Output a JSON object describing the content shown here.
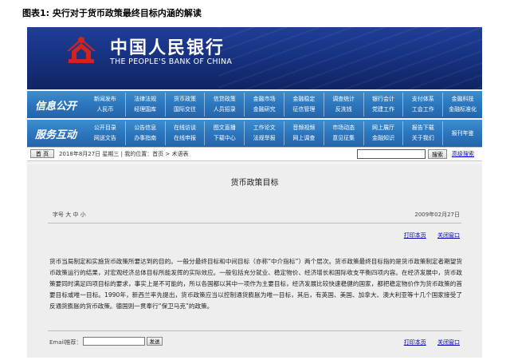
{
  "figure_caption": "图表1:    央行对于货币政策最终目标内涵的解读",
  "header": {
    "bank_name_cn": "中国人民银行",
    "bank_name_en": "THE PEOPLE'S BANK OF CHINA"
  },
  "nav": [
    {
      "heading": "信息公开",
      "items": [
        [
          "新闻发布",
          "人民币"
        ],
        [
          "法律法规",
          "经理国库"
        ],
        [
          "货币政策",
          "国际交往"
        ],
        [
          "信贷政策",
          "人员招录"
        ],
        [
          "金融市场",
          "金融研究"
        ],
        [
          "金融稳定",
          "征信管理"
        ],
        [
          "调查统计",
          "反洗钱"
        ],
        [
          "银行会计",
          "党建工作"
        ],
        [
          "支付体系",
          "工会工作"
        ],
        [
          "金融科技",
          "金融标准化"
        ]
      ]
    },
    {
      "heading": "服务互动",
      "items": [
        [
          "公开目录",
          "网送文告"
        ],
        [
          "公告信息",
          "办事指南"
        ],
        [
          "在线访谈",
          "在线申报"
        ],
        [
          "图文直播",
          "下载中心"
        ],
        [
          "工作论文",
          "法规举报"
        ],
        [
          "音频视频",
          "网上调查"
        ],
        [
          "市场动态",
          "意见征集"
        ],
        [
          "网上展厅",
          "金融知识"
        ],
        [
          "报告下载",
          "关于我们"
        ],
        [
          "报刊年鉴",
          ""
        ]
      ]
    }
  ],
  "crumbbar": {
    "home_label": "首 页",
    "crumb_text": "2018年8月27日  星期三  |  我的位置：首页 > 术语表",
    "search_button": "搜索",
    "advanced_search": "高级搜索"
  },
  "article": {
    "title": "货币政策目标",
    "font_size_label": "字号  大  中  小",
    "date": "2009年02月27日",
    "print_label": "打印本页",
    "close_label": "关闭窗口",
    "body": "货币当局制定和实施货币政策所要达到的目的。一般分最终目标和中间目标（亦称“中介指标”）两个层次。货币政策最终目标指的是货币政策制定者期望货币政策运行的结果，对宏观经济总体目标所能发挥的实际效应。一般包括充分就业、稳定物价、经济增长和国际收支平衡四项内容。在经济发展中，货币政策要同时满足四项目标的要求，事实上是不可能的，所以各国都以其中一项作为主要目标，经济发展比较快速稳健的国家，都把稳定物价作为货币政策的首要目标或唯一目标。1990年，新西兰率先提出，货币政策应当以控制通货膨胀为唯一目标，其后，有英国、美国、加拿大、澳大利亚等十几个国家接受了反通货膨胀的货币政策。德国则一贯奉行“保卫马克”的政策。",
    "email_label": "Email推荐：",
    "send_label": "发送"
  },
  "colors": {
    "header_blue": "#16307d",
    "nav_blue": "#2c76bd",
    "emblem_red": "#d2231f"
  }
}
